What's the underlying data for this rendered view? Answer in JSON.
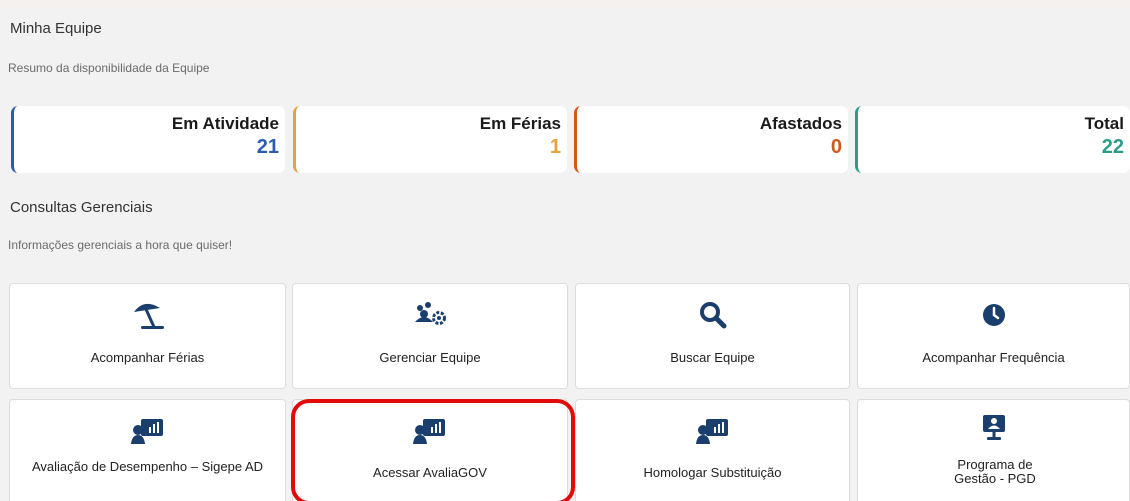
{
  "team": {
    "title": "Minha Equipe",
    "subtitle": "Resumo da disponibilidade da Equipe",
    "stats": [
      {
        "label": "Em Atividade",
        "value": "21",
        "color": "#2a5db0"
      },
      {
        "label": "Em Férias",
        "value": "1",
        "color": "#e8a23a"
      },
      {
        "label": "Afastados",
        "value": "0",
        "color": "#d2591e"
      },
      {
        "label": "Total",
        "value": "22",
        "color": "#2b9c86"
      }
    ]
  },
  "management": {
    "title": "Consultas Gerenciais",
    "subtitle": "Informações gerenciais a hora que quiser!",
    "cards": [
      {
        "label": "Acompanhar Férias",
        "icon": "umbrella-beach-icon"
      },
      {
        "label": "Gerenciar Equipe",
        "icon": "users-gear-icon"
      },
      {
        "label": "Buscar Equipe",
        "icon": "search-icon"
      },
      {
        "label": "Acompanhar Frequência",
        "icon": "clock-icon"
      },
      {
        "label": "Avaliação de Desempenho – Sigepe AD",
        "icon": "chalkboard-user-icon"
      },
      {
        "label": "Acessar AvaliaGOV",
        "icon": "chalkboard-user-icon"
      },
      {
        "label": "Homologar Substituição",
        "icon": "chalkboard-user-icon"
      },
      {
        "label": "Programa de Gestão - PGD",
        "icon": "user-monitor-icon"
      }
    ]
  },
  "accent_color": "#1b3f6d",
  "highlight_color": "#e20a0a"
}
